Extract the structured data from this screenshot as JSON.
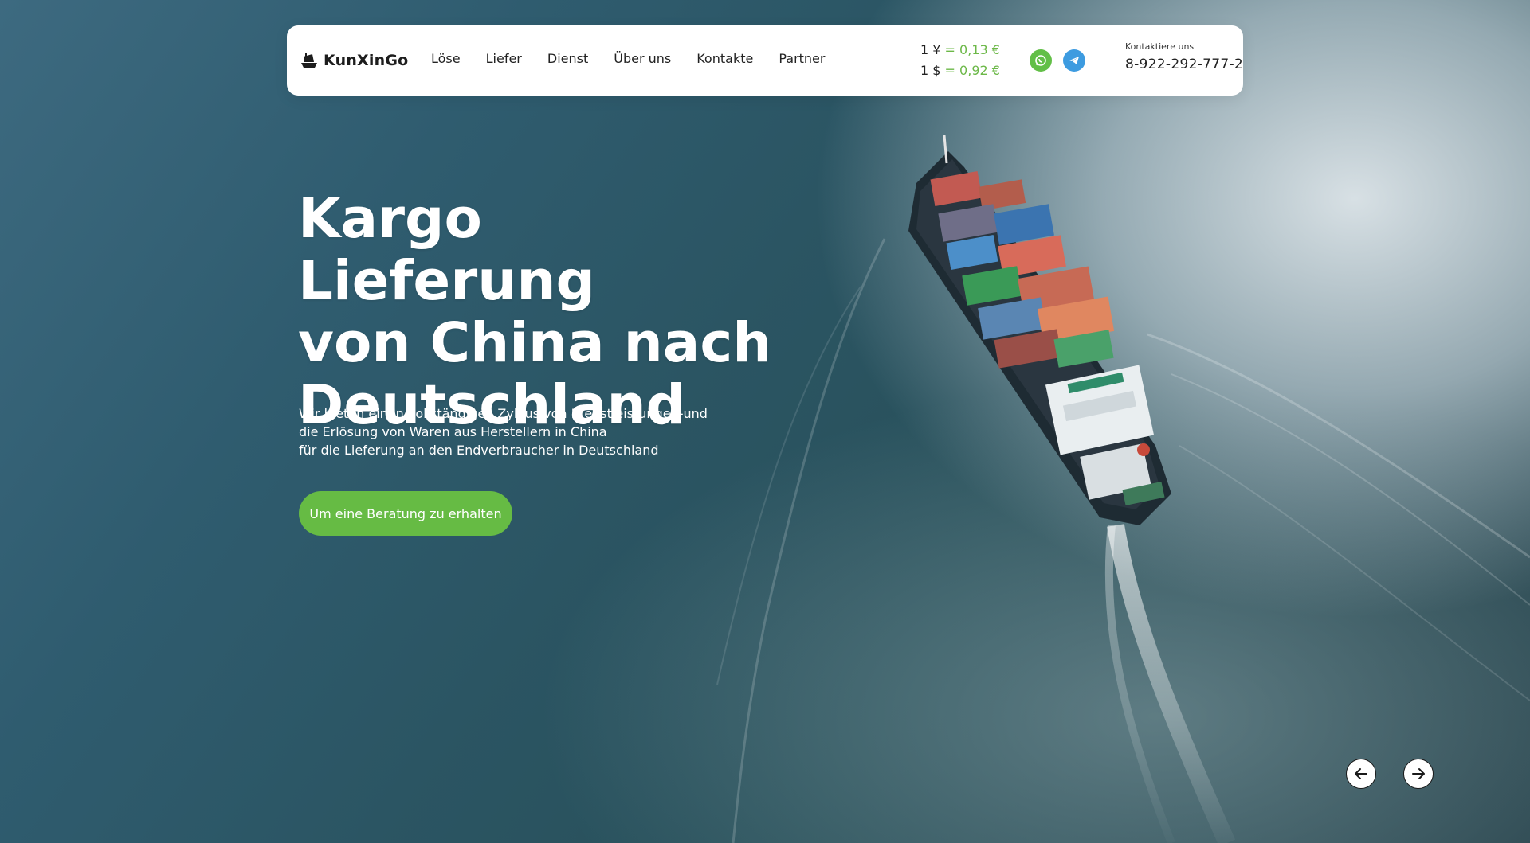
{
  "header": {
    "brand": "KunXinGo",
    "nav": [
      "Löse",
      "Liefer",
      "Dienst",
      "Über uns",
      "Kontakte",
      "Partner"
    ],
    "rates": [
      {
        "base": "1 ¥",
        "eq": "=",
        "value": "0,13 €"
      },
      {
        "base": "1 $",
        "eq": "=",
        "value": "0,92 €"
      }
    ],
    "contact_label": "Kontaktiere uns",
    "phone": "8-922-292-777-2"
  },
  "hero": {
    "title_lines": [
      "Kargo Lieferung",
      "von China nach",
      "Deutschland"
    ],
    "subtitle_lines": [
      "Wir bieten einen vollständigen Zyklus von Dienstleistungen-und",
      "die Erlösung von Waren aus Herstellern in China",
      "für die Lieferung an den Endverbraucher in Deutschland"
    ],
    "cta_label": "Um eine Beratung zu erhalten"
  },
  "icons": {
    "logo": "ship-icon",
    "whatsapp": "whatsapp-icon",
    "telegram": "telegram-icon",
    "prev": "arrow-left-icon",
    "next": "arrow-right-icon"
  },
  "colors": {
    "accent": "#66bb44",
    "whatsapp": "#62bf47",
    "telegram": "#3d9be0"
  }
}
